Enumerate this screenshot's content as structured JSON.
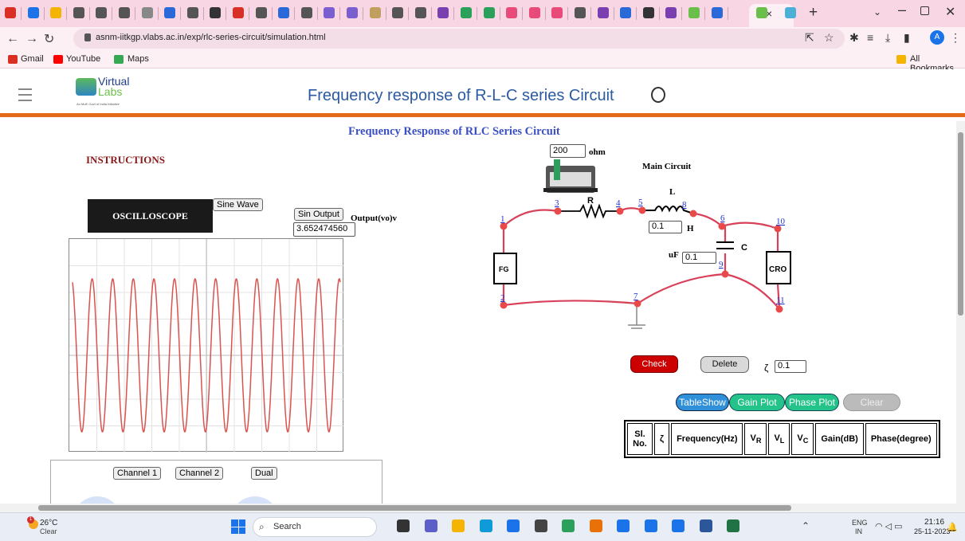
{
  "browser": {
    "address_url": "asnm-iitkgp.vlabs.ac.in/exp/rlc-series-circuit/simulation.html",
    "new_tab": "+",
    "tab_close": "×",
    "bookmarks": [
      {
        "label": "Gmail",
        "icon": "gmail-icon",
        "color": "#d93025"
      },
      {
        "label": "YouTube",
        "icon": "youtube-icon",
        "color": "#ff0000"
      },
      {
        "label": "Maps",
        "icon": "maps-icon",
        "color": "#34a853"
      }
    ],
    "all_bookmarks": "All Bookmarks",
    "profile_initial": "A"
  },
  "header": {
    "logo_text_1": "Virtual",
    "logo_text_2": "Labs",
    "logo_tagline": "An MoE Govt of India Initiative",
    "page_title": "Frequency response of R-L-C series Circuit"
  },
  "simulation": {
    "title": "Frequency Response of RLC Series Circuit",
    "instructions": "INSTRUCTIONS",
    "oscilloscope_label": "OSCILLOSCOPE",
    "sine_wave_btn": "Sine Wave",
    "sin_output_btn": "Sin Output",
    "output_label": "Output(vo)v",
    "output_value": "3.652474560",
    "channel_buttons": [
      "Channel 1",
      "Channel 2",
      "Dual"
    ],
    "waveform": {
      "cycles": 13,
      "color": "#d9534f"
    }
  },
  "circuit": {
    "main_label": "Main Circuit",
    "resistance_value": "200",
    "resistance_unit": "ohm",
    "resistor_label": "R",
    "inductor_label": "L",
    "inductance_value": "0.1",
    "inductance_unit": "H",
    "capacitor_label": "C",
    "capacitance_unit": "uF",
    "capacitance_value": "0.1",
    "fg_label": "FG",
    "cro_label": "CRO",
    "nodes": [
      "1",
      "2",
      "3",
      "4",
      "5",
      "6",
      "7",
      "8",
      "9",
      "10",
      "11"
    ],
    "wire_color": "#d9415a"
  },
  "controls": {
    "check": "Check",
    "delete": "Delete",
    "zeta_symbol": "ζ",
    "zeta_value": "0.1",
    "tableshow": "TableShow",
    "gain_plot": "Gain Plot",
    "phase_plot": "Phase Plot",
    "clear": "Clear"
  },
  "table": {
    "headers": [
      "Sl. No.",
      "ζ",
      "Frequency(Hz)",
      "V",
      "V",
      "V",
      "Gain(dB)",
      "Phase(degree)"
    ],
    "subscripts": [
      "R",
      "L",
      "C"
    ]
  },
  "taskbar": {
    "temperature": "26°C",
    "condition": "Clear",
    "search_placeholder": "Search",
    "lang_1": "ENG",
    "lang_2": "IN",
    "time": "21:16",
    "date": "25-11-2023"
  }
}
